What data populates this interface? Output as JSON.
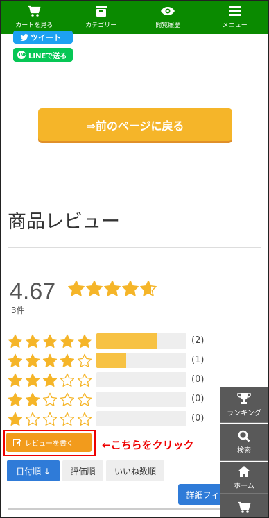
{
  "nav": {
    "items": [
      {
        "label": "カートを見る",
        "icon": "cart-icon"
      },
      {
        "label": "カテゴリー",
        "icon": "category-icon"
      },
      {
        "label": "閲覧履歴",
        "icon": "eye-icon"
      },
      {
        "label": "メニュー",
        "icon": "menu-icon"
      }
    ],
    "color": "#0a8a00"
  },
  "share": {
    "tweet_label": "ツイート",
    "line_label": "LINEで送る",
    "line_icon_text": "LINE"
  },
  "back_button": {
    "label": "⇒前のページに戻る"
  },
  "reviews": {
    "title": "商品レビュー",
    "average": "4.67",
    "average_value": 4.67,
    "count": "3件",
    "distribution": [
      {
        "stars": 5,
        "count_label": "(2)",
        "share": 0.667
      },
      {
        "stars": 4,
        "count_label": "(1)",
        "share": 0.333
      },
      {
        "stars": 3,
        "count_label": "(0)",
        "share": 0
      },
      {
        "stars": 2,
        "count_label": "(0)",
        "share": 0
      },
      {
        "stars": 1,
        "count_label": "(0)",
        "share": 0
      }
    ],
    "star_color": "#f5b529",
    "write_button": "レビューを書く",
    "click_note": "←こちらをクリック",
    "sort": {
      "date": "日付順 ↓",
      "rating": "評価順",
      "likes": "いいね数順"
    },
    "filter": "詳細フィルター"
  },
  "side_menu": {
    "ranking": "ランキング",
    "search": "検索",
    "home": "ホーム"
  }
}
